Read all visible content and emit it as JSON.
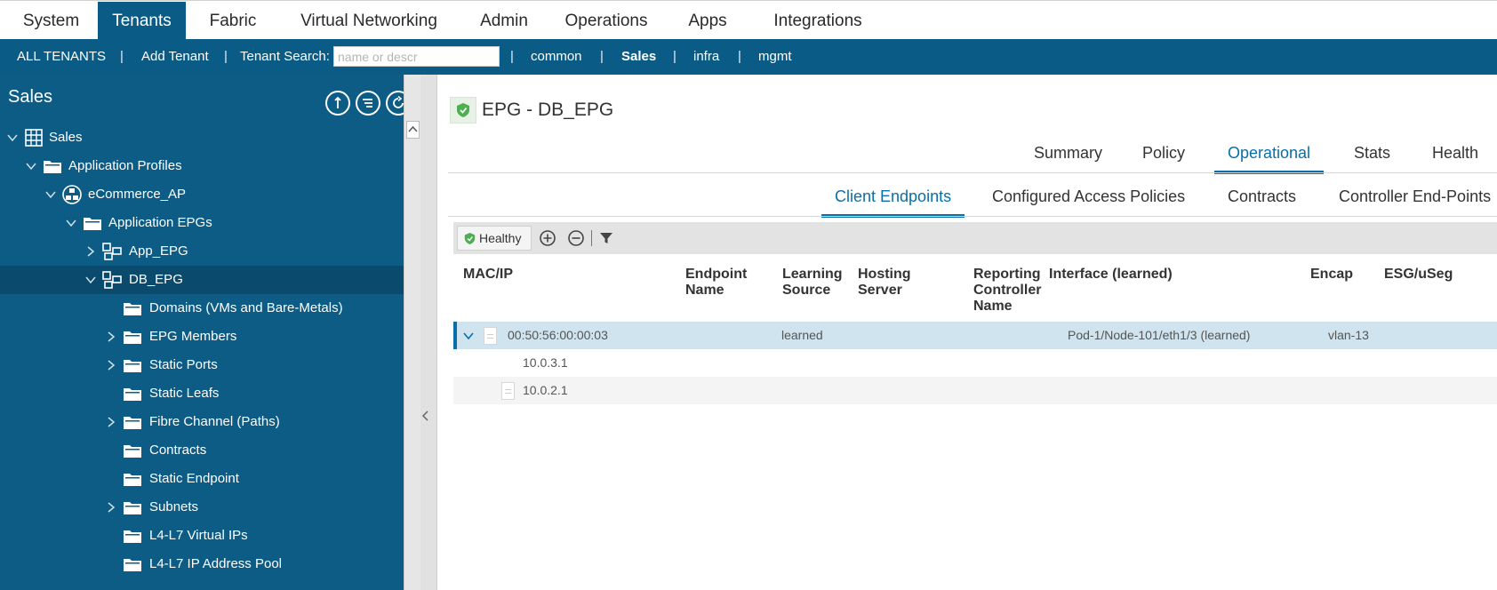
{
  "top_nav": {
    "tabs": [
      "System",
      "Tenants",
      "Fabric",
      "Virtual Networking",
      "Admin",
      "Operations",
      "Apps",
      "Integrations"
    ],
    "active": "Tenants"
  },
  "tenant_bar": {
    "all_tenants": "ALL TENANTS",
    "add_tenant": "Add Tenant",
    "search_label": "Tenant Search:",
    "search_placeholder": "name or descr",
    "separator": "|",
    "tenants": [
      "common",
      "Sales",
      "infra",
      "mgmt"
    ],
    "current_tenant": "Sales"
  },
  "sidebar": {
    "title": "Sales",
    "tree": [
      {
        "label": "Sales",
        "expanded": true,
        "icon": "tenant-grid-icon"
      },
      {
        "label": "Application Profiles",
        "expanded": true,
        "icon": "folder-icon"
      },
      {
        "label": "eCommerce_AP",
        "expanded": true,
        "icon": "app-profile-icon"
      },
      {
        "label": "Application EPGs",
        "expanded": true,
        "icon": "folder-icon"
      },
      {
        "label": "App_EPG",
        "expanded": false,
        "icon": "epg-icon"
      },
      {
        "label": "DB_EPG",
        "expanded": true,
        "icon": "epg-icon",
        "selected": true
      },
      {
        "label": "Domains (VMs and Bare-Metals)",
        "icon": "folder-icon"
      },
      {
        "label": "EPG Members",
        "expanded": false,
        "icon": "folder-icon"
      },
      {
        "label": "Static Ports",
        "expanded": false,
        "icon": "folder-icon"
      },
      {
        "label": "Static Leafs",
        "icon": "folder-icon"
      },
      {
        "label": "Fibre Channel (Paths)",
        "expanded": false,
        "icon": "folder-icon"
      },
      {
        "label": "Contracts",
        "icon": "folder-icon"
      },
      {
        "label": "Static Endpoint",
        "icon": "folder-icon"
      },
      {
        "label": "Subnets",
        "expanded": false,
        "icon": "folder-icon"
      },
      {
        "label": "L4-L7 Virtual IPs",
        "icon": "folder-icon"
      },
      {
        "label": "L4-L7 IP Address Pool",
        "icon": "folder-icon"
      }
    ]
  },
  "main": {
    "title": "EPG - DB_EPG",
    "tabs": [
      "Summary",
      "Policy",
      "Operational",
      "Stats",
      "Health"
    ],
    "active_tab": "Operational",
    "subtabs": [
      "Client Endpoints",
      "Configured Access Policies",
      "Contracts",
      "Controller End-Points"
    ],
    "active_subtab": "Client Endpoints",
    "toolbar": {
      "health_label": "Healthy"
    },
    "table": {
      "columns": [
        [
          "MAC/IP"
        ],
        [
          "Endpoint",
          "Name"
        ],
        [
          "Learning",
          "Source"
        ],
        [
          "Hosting",
          "Server"
        ],
        [
          "Reporting",
          "Controller",
          "Name"
        ],
        [
          "Interface (learned)"
        ],
        [
          "Encap"
        ],
        [
          "ESG/uSeg"
        ]
      ],
      "rows": [
        {
          "mac_ip": "00:50:56:00:00:03",
          "learning_source": "learned",
          "interface": "Pod-1/Node-101/eth1/3 (learned)",
          "encap": "vlan-13"
        },
        {
          "mac_ip": "10.0.3.1"
        },
        {
          "mac_ip": "10.0.2.1"
        }
      ]
    }
  },
  "colors": {
    "brand_blue": "#0a5c86",
    "accent_blue": "#0a6fa8",
    "healthy_green": "#4caf50"
  }
}
